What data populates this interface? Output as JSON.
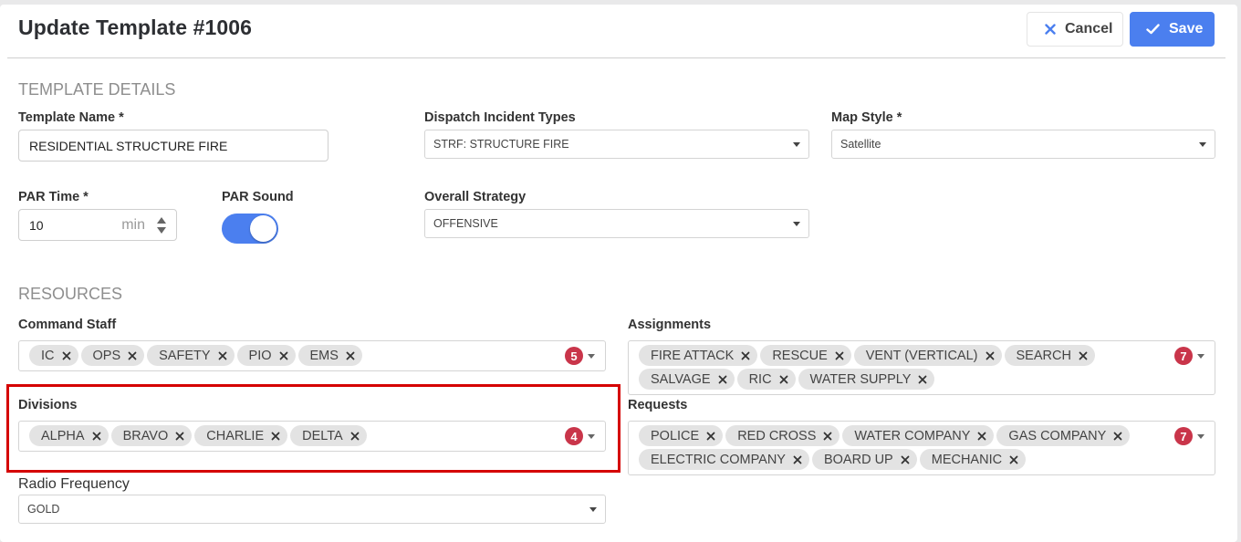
{
  "header": {
    "title": "Update Template #1006",
    "cancel_label": "Cancel",
    "save_label": "Save"
  },
  "template_details": {
    "section_title": "TEMPLATE DETAILS",
    "template_name": {
      "label": "Template Name",
      "required": "*",
      "value": "RESIDENTIAL STRUCTURE FIRE"
    },
    "dispatch_incident_types": {
      "label": "Dispatch Incident Types",
      "value": "STRF: STRUCTURE FIRE"
    },
    "map_style": {
      "label": "Map Style",
      "required": "*",
      "value": "Satellite"
    },
    "par_time": {
      "label": "PAR Time",
      "required": "*",
      "value": "10",
      "unit": "min"
    },
    "par_sound": {
      "label": "PAR Sound",
      "enabled": true
    },
    "overall_strategy": {
      "label": "Overall Strategy",
      "value": "OFFENSIVE"
    }
  },
  "resources": {
    "section_title": "RESOURCES",
    "command_staff": {
      "label": "Command Staff",
      "count": "5",
      "items": [
        "IC",
        "OPS",
        "SAFETY",
        "PIO",
        "EMS"
      ]
    },
    "assignments": {
      "label": "Assignments",
      "count": "7",
      "items": [
        "FIRE ATTACK",
        "RESCUE",
        "VENT (VERTICAL)",
        "SEARCH",
        "SALVAGE",
        "RIC",
        "WATER SUPPLY"
      ]
    },
    "divisions": {
      "label": "Divisions",
      "count": "4",
      "items": [
        "ALPHA",
        "BRAVO",
        "CHARLIE",
        "DELTA"
      ]
    },
    "requests": {
      "label": "Requests",
      "count": "7",
      "items": [
        "POLICE",
        "RED CROSS",
        "WATER COMPANY",
        "GAS COMPANY",
        "ELECTRIC COMPANY",
        "BOARD UP",
        "MECHANIC"
      ]
    },
    "radio_frequency": {
      "label": "Radio Frequency",
      "value": "GOLD"
    }
  },
  "colors": {
    "accent": "#4b7fef",
    "badge": "#c9354a",
    "highlight": "#d50000"
  }
}
